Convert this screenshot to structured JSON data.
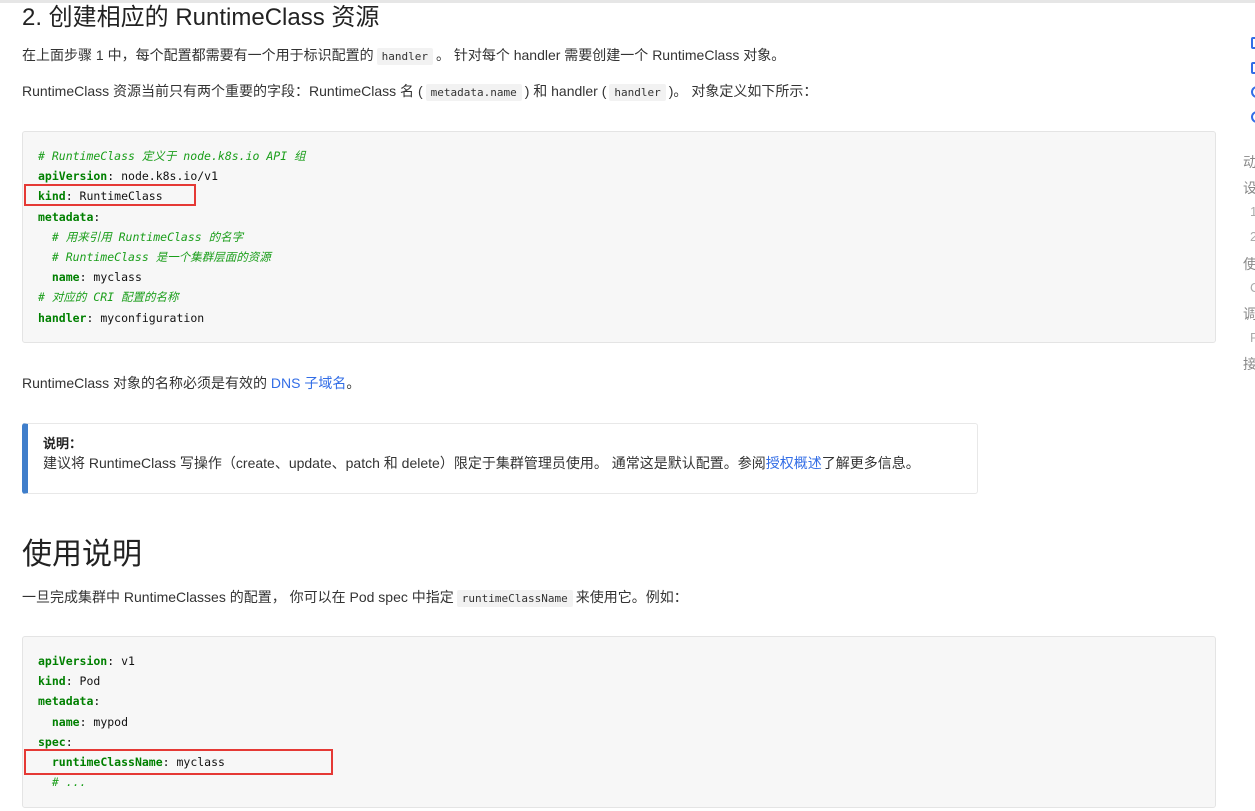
{
  "section2": {
    "title": "2. 创建相应的 RuntimeClass 资源",
    "p1": {
      "a": "在上面步骤 1 中，每个配置都需要有一个用于标识配置的",
      "code": "handler",
      "b": "。 针对每个 handler 需要创建一个 RuntimeClass 对象。"
    },
    "p2": {
      "a": "RuntimeClass 资源当前只有两个重要的字段：RuntimeClass 名 (",
      "code1": "metadata.name",
      "b": ") 和 handler (",
      "code2": "handler",
      "c": ")。 对象定义如下所示："
    },
    "code": {
      "l1": "# RuntimeClass 定义于 node.k8s.io API 组",
      "l2k": "apiVersion",
      "l2v": ": node.k8s.io/v1",
      "l3k": "kind",
      "l3v": ": RuntimeClass",
      "l4k": "metadata",
      "l4v": ":",
      "l5": "  # 用来引用 RuntimeClass 的名字",
      "l6": "  # RuntimeClass 是一个集群层面的资源",
      "l7i": "  ",
      "l7k": "name",
      "l7v": ": myclass",
      "l8": "# 对应的 CRI 配置的名称",
      "l9k": "handler",
      "l9v": ": myconfiguration"
    },
    "p3": {
      "a": "RuntimeClass 对象的名称必须是有效的 ",
      "link": "DNS 子域名",
      "b": "。"
    },
    "note": {
      "title": "说明：",
      "a": "建议将 RuntimeClass 写操作（create、update、patch 和 delete）限定于集群管理员使用。 通常这是默认配置。参阅",
      "link": "授权概述",
      "b": "了解更多信息。"
    }
  },
  "usage": {
    "title": "使用说明",
    "p1": {
      "a": "一旦完成集群中 RuntimeClasses 的配置， 你可以在 Pod spec 中指定",
      "code": "runtimeClassName",
      "b": "来使用它。例如："
    },
    "code": {
      "l1k": "apiVersion",
      "l1v": ": v1",
      "l2k": "kind",
      "l2v": ": Pod",
      "l3k": "metadata",
      "l3v": ":",
      "l4i": "  ",
      "l4k": "name",
      "l4v": ": mypod",
      "l5k": "spec",
      "l5v": ":",
      "l6i": "  ",
      "l6k": "runtimeClassName",
      "l6v": ": myclass",
      "l7": "  # ..."
    }
  },
  "toc": {
    "items": [
      "动",
      "设",
      "1",
      "2",
      "使",
      "C",
      "调",
      "F",
      "接"
    ]
  },
  "colors": {
    "accent": "#326de6",
    "highlight": "#e53935",
    "note_bar": "#3f7ecb"
  }
}
